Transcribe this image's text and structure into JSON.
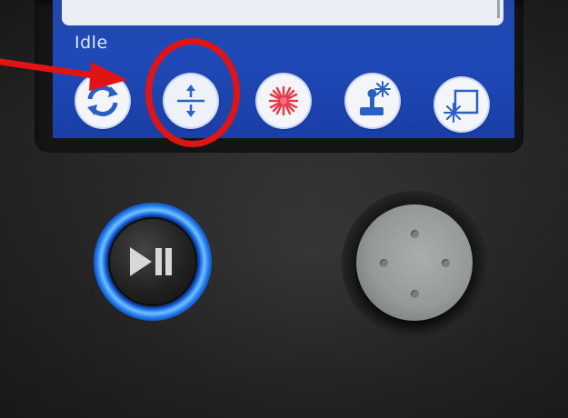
{
  "screen": {
    "status": "Idle"
  },
  "toolbar": {
    "buttons": [
      {
        "name": "refresh",
        "icon": "refresh-icon"
      },
      {
        "name": "focus-z-axis",
        "icon": "vertical-arrows-icon",
        "highlighted": true
      },
      {
        "name": "laser",
        "icon": "laser-burst-icon"
      },
      {
        "name": "laser-jog",
        "icon": "joystick-laser-icon"
      },
      {
        "name": "frame",
        "icon": "frame-laser-icon"
      }
    ]
  },
  "annotation": {
    "highlight_color": "#e01414",
    "arrow_color": "#e01414"
  },
  "controls": {
    "play_pause_icon": "play-pause-icon",
    "joystick": "joystick"
  },
  "colors": {
    "screen_blue": "#1f49b8",
    "laser_red": "#e33a4a",
    "ring_blue": "#1b6ee8"
  }
}
